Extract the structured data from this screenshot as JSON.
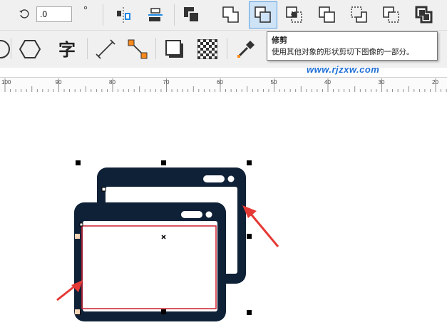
{
  "property_bar": {
    "rotation_value": ".0",
    "degree_symbol": "°"
  },
  "tooltip": {
    "title": "修剪",
    "description": "使用其他对象的形状剪切下图像的一部分。"
  },
  "watermark": "www.rjzxw.com",
  "ruler": {
    "labels": [
      "100",
      "90",
      "80",
      "70",
      "60",
      "50",
      "40",
      "30",
      "20"
    ]
  },
  "colors": {
    "shape_fill": "#0f2137",
    "selection_outline": "#cc1e2e",
    "arrow": "#e53935",
    "active_button": "#cfe3f6"
  },
  "icons": {
    "toolbar_row1": [
      "rotate-icon",
      "mirror-icon",
      "align-icon",
      "back-minus-front-icon",
      "weld-icon",
      "trim-icon",
      "intersect-icon",
      "simplify-icon",
      "front-minus-back-icon",
      "back-minus-front-alt-icon",
      "boundary-icon"
    ],
    "toolbar_row2": [
      "ellipse-tool-icon",
      "polygon-tool-icon",
      "text-tool-icon",
      "dimension-tool-icon",
      "connector-tool-icon",
      "drop-shadow-icon",
      "transparency-icon",
      "eyedropper-icon"
    ]
  }
}
